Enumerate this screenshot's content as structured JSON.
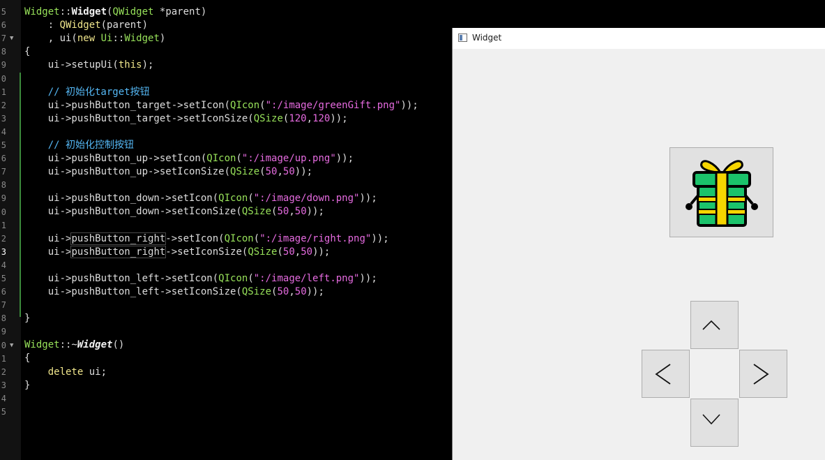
{
  "editor": {
    "gutter": {
      "lines": [
        "5",
        "6",
        "7",
        "8",
        "9",
        "0",
        "1",
        "2",
        "3",
        "4",
        "5",
        "6",
        "7",
        "8",
        "9",
        "0",
        "1",
        "2",
        "3",
        "4",
        "5",
        "6",
        "7",
        "8",
        "9",
        "0",
        "1",
        "2",
        "3",
        "4",
        "5"
      ],
      "current_line_index": 18,
      "fold_marker_rows": [
        2,
        25
      ]
    },
    "code_lines": [
      [
        {
          "t": "Widget",
          "c": "type"
        },
        {
          "t": "::",
          "c": "text"
        },
        {
          "t": "Widget",
          "c": "bold"
        },
        {
          "t": "(",
          "c": "text"
        },
        {
          "t": "QWidget",
          "c": "type"
        },
        {
          "t": " *parent)",
          "c": "text"
        }
      ],
      [
        {
          "t": "    : ",
          "c": "text"
        },
        {
          "t": "QWidget",
          "c": "kw"
        },
        {
          "t": "(parent)",
          "c": "text"
        }
      ],
      [
        {
          "t": "    , ui(",
          "c": "text"
        },
        {
          "t": "new",
          "c": "kw"
        },
        {
          "t": " ",
          "c": "text"
        },
        {
          "t": "Ui",
          "c": "type"
        },
        {
          "t": "::",
          "c": "text"
        },
        {
          "t": "Widget",
          "c": "type"
        },
        {
          "t": ")",
          "c": "text"
        }
      ],
      [
        {
          "t": "{",
          "c": "text"
        }
      ],
      [
        {
          "t": "    ui->setupUi(",
          "c": "text"
        },
        {
          "t": "this",
          "c": "kw"
        },
        {
          "t": ");",
          "c": "text"
        }
      ],
      [],
      [
        {
          "t": "    // 初始化target按钮",
          "c": "cmt"
        }
      ],
      [
        {
          "t": "    ui->pushButton_target->setIcon(",
          "c": "text"
        },
        {
          "t": "QIcon",
          "c": "type"
        },
        {
          "t": "(",
          "c": "text"
        },
        {
          "t": "\":/image/greenGift.png\"",
          "c": "str"
        },
        {
          "t": "));",
          "c": "text"
        }
      ],
      [
        {
          "t": "    ui->pushButton_target->setIconSize(",
          "c": "text"
        },
        {
          "t": "QSize",
          "c": "type"
        },
        {
          "t": "(",
          "c": "text"
        },
        {
          "t": "120",
          "c": "num"
        },
        {
          "t": ",",
          "c": "text"
        },
        {
          "t": "120",
          "c": "num"
        },
        {
          "t": "));",
          "c": "text"
        }
      ],
      [],
      [
        {
          "t": "    // 初始化控制按钮",
          "c": "cmt"
        }
      ],
      [
        {
          "t": "    ui->pushButton_up->setIcon(",
          "c": "text"
        },
        {
          "t": "QIcon",
          "c": "type"
        },
        {
          "t": "(",
          "c": "text"
        },
        {
          "t": "\":/image/up.png\"",
          "c": "str"
        },
        {
          "t": "));",
          "c": "text"
        }
      ],
      [
        {
          "t": "    ui->pushButton_up->setIconSize(",
          "c": "text"
        },
        {
          "t": "QSize",
          "c": "type"
        },
        {
          "t": "(",
          "c": "text"
        },
        {
          "t": "50",
          "c": "num"
        },
        {
          "t": ",",
          "c": "text"
        },
        {
          "t": "50",
          "c": "num"
        },
        {
          "t": "));",
          "c": "text"
        }
      ],
      [],
      [
        {
          "t": "    ui->pushButton_down->setIcon(",
          "c": "text"
        },
        {
          "t": "QIcon",
          "c": "type"
        },
        {
          "t": "(",
          "c": "text"
        },
        {
          "t": "\":/image/down.png\"",
          "c": "str"
        },
        {
          "t": "));",
          "c": "text"
        }
      ],
      [
        {
          "t": "    ui->pushButton_down->setIconSize(",
          "c": "text"
        },
        {
          "t": "QSize",
          "c": "type"
        },
        {
          "t": "(",
          "c": "text"
        },
        {
          "t": "50",
          "c": "num"
        },
        {
          "t": ",",
          "c": "text"
        },
        {
          "t": "50",
          "c": "num"
        },
        {
          "t": "));",
          "c": "text"
        }
      ],
      [],
      [
        {
          "t": "    ui->",
          "c": "text"
        },
        {
          "t": "pushButton_right",
          "c": "box"
        },
        {
          "t": "->setIcon(",
          "c": "text"
        },
        {
          "t": "QIcon",
          "c": "type"
        },
        {
          "t": "(",
          "c": "text"
        },
        {
          "t": "\":/image/right.png\"",
          "c": "str"
        },
        {
          "t": "));",
          "c": "text"
        }
      ],
      [
        {
          "t": "    ui->",
          "c": "text"
        },
        {
          "t": "pushButton_right",
          "c": "box"
        },
        {
          "t": "->setIconSize(",
          "c": "text"
        },
        {
          "t": "QSize",
          "c": "type"
        },
        {
          "t": "(",
          "c": "text"
        },
        {
          "t": "50",
          "c": "num"
        },
        {
          "t": ",",
          "c": "text"
        },
        {
          "t": "50",
          "c": "num"
        },
        {
          "t": "));",
          "c": "text"
        }
      ],
      [],
      [
        {
          "t": "    ui->pushButton_left->setIcon(",
          "c": "text"
        },
        {
          "t": "QIcon",
          "c": "type"
        },
        {
          "t": "(",
          "c": "text"
        },
        {
          "t": "\":/image/left.png\"",
          "c": "str"
        },
        {
          "t": "));",
          "c": "text"
        }
      ],
      [
        {
          "t": "    ui->pushButton_left->setIconSize(",
          "c": "text"
        },
        {
          "t": "QSize",
          "c": "type"
        },
        {
          "t": "(",
          "c": "text"
        },
        {
          "t": "50",
          "c": "num"
        },
        {
          "t": ",",
          "c": "text"
        },
        {
          "t": "50",
          "c": "num"
        },
        {
          "t": "));",
          "c": "text"
        }
      ],
      [],
      [
        {
          "t": "}",
          "c": "text"
        }
      ],
      [],
      [
        {
          "t": "Widget",
          "c": "type"
        },
        {
          "t": "::~",
          "c": "text"
        },
        {
          "t": "Widget",
          "c": "boldital"
        },
        {
          "t": "()",
          "c": "text"
        }
      ],
      [
        {
          "t": "{",
          "c": "text"
        }
      ],
      [
        {
          "t": "    ",
          "c": "text"
        },
        {
          "t": "delete",
          "c": "kw"
        },
        {
          "t": " ui;",
          "c": "text"
        }
      ],
      [
        {
          "t": "}",
          "c": "text"
        }
      ],
      [],
      []
    ]
  },
  "widget_window": {
    "title": "Widget",
    "buttons": {
      "target": {
        "icon": "green-gift-icon",
        "colors": {
          "box": "#1bc36b",
          "ribbon": "#f6d500",
          "outline": "#000000"
        }
      },
      "up": {
        "icon": "chevron-up-icon"
      },
      "left": {
        "icon": "chevron-left-icon"
      },
      "right": {
        "icon": "chevron-right-icon"
      },
      "down": {
        "icon": "chevron-down-icon"
      }
    }
  }
}
